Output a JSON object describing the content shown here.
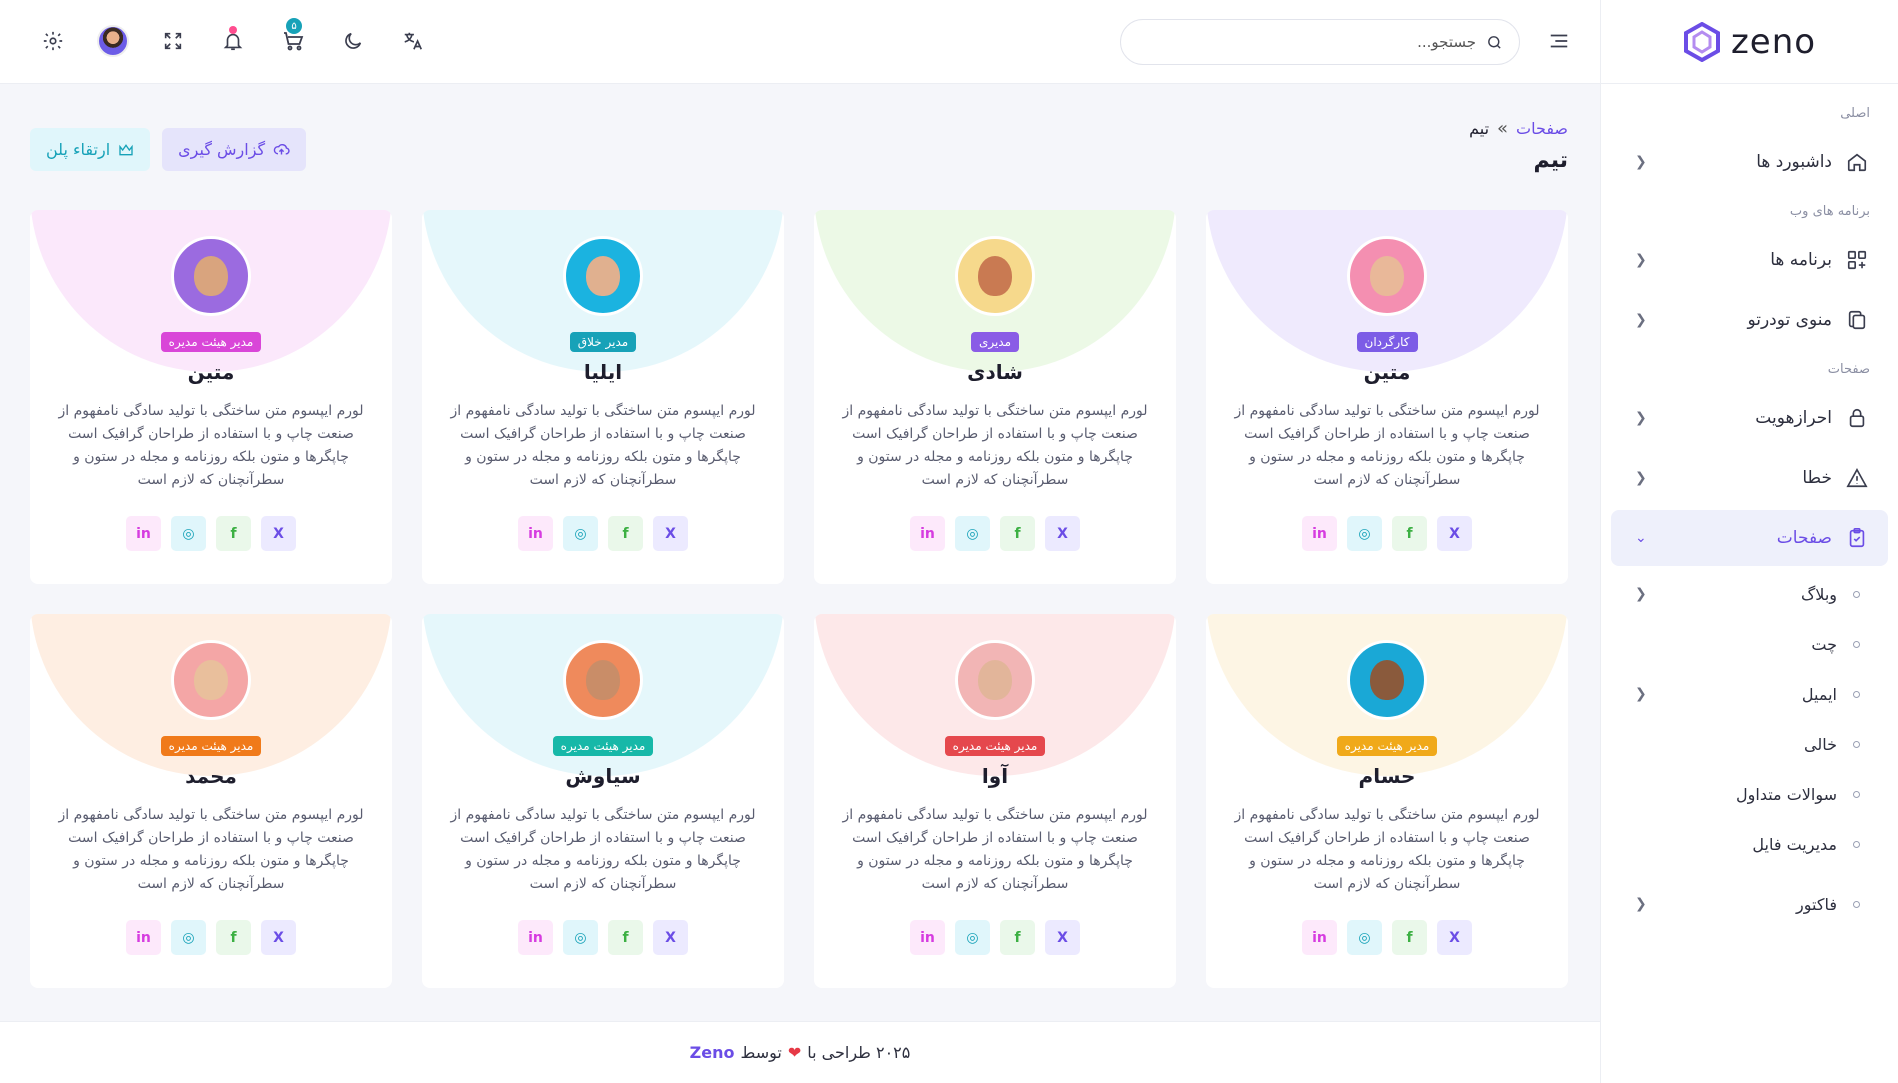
{
  "brand": {
    "name": "zeno"
  },
  "header": {
    "search_placeholder": "جستجو...",
    "cart_count": "۵"
  },
  "sidebar": {
    "sections": {
      "main": "اصلی",
      "webapps": "برنامه های وب",
      "pages": "صفحات"
    },
    "items": {
      "dashboards": "داشبورد ها",
      "apps": "برنامه ها",
      "nested": "منوی تودرتو",
      "auth": "احرازهویت",
      "error": "خطا",
      "pages": "صفحات",
      "blog": "وبلاگ",
      "chat": "چت",
      "email": "ایمیل",
      "empty": "خالی",
      "faq": "سوالات متداول",
      "files": "مدیریت فایل",
      "invoice": "فاکتور"
    }
  },
  "breadcrumb": {
    "link": "صفحات",
    "sep": "»",
    "current": "تیم"
  },
  "page_title": "تیم",
  "buttons": {
    "report": "گزارش گیری",
    "upgrade": "ارتقاء پلن"
  },
  "description": "لورم ایپسوم متن ساختگی با تولید سادگی نامفهوم از صنعت چاپ و با استفاده از طراحان گرافیک است چاپگرها و متون بلکه روزنامه و مجله در ستون و سطرآنچنان که لازم است",
  "members": [
    {
      "name": "متین",
      "role": "کارگردان",
      "role_color": "#7c5ce6",
      "arc": "#e4dcfb",
      "photo": "#f48fb1",
      "skin": "#e9b899"
    },
    {
      "name": "شادی",
      "role": "مدیری",
      "role_color": "#8a5ce6",
      "arc": "#dff5d6",
      "photo": "#f6d98c",
      "skin": "#c97a52"
    },
    {
      "name": "ایلیا",
      "role": "مدیر خلاق",
      "role_color": "#17a2b8",
      "arc": "#d4f1f8",
      "photo": "#1bb3e0",
      "skin": "#e0b08f"
    },
    {
      "name": "متین",
      "role": "مدیر هیئت مدیره",
      "role_color": "#d946d8",
      "arc": "#f9d9f9",
      "photo": "#9b6be0",
      "skin": "#d9a47e"
    },
    {
      "name": "حسام",
      "role": "مدیر هیئت مدیره",
      "role_color": "#f0a91a",
      "arc": "#fcefd2",
      "photo": "#1aa8d6",
      "skin": "#8a5a3c"
    },
    {
      "name": "آوا",
      "role": "مدیر هیئت مدیره",
      "role_color": "#e5484d",
      "arc": "#fbd9da",
      "photo": "#f2b5b5",
      "skin": "#e2b59a"
    },
    {
      "name": "سیاوش",
      "role": "مدیر هیئت مدیره",
      "role_color": "#17b8a8",
      "arc": "#d4f1f8",
      "photo": "#ef8a5c",
      "skin": "#c98d68"
    },
    {
      "name": "محمد",
      "role": "مدیر هیئت مدیره",
      "role_color": "#f07a1a",
      "arc": "#fde3cf",
      "photo": "#f4a6a6",
      "skin": "#e9bf9c"
    }
  ],
  "social": {
    "x": "X",
    "fb": "f",
    "ig": "◎",
    "li": "in"
  },
  "footer": {
    "text1": "۲۰۲۵ طراحی با",
    "text2": "توسط",
    "brand": "Zeno"
  }
}
